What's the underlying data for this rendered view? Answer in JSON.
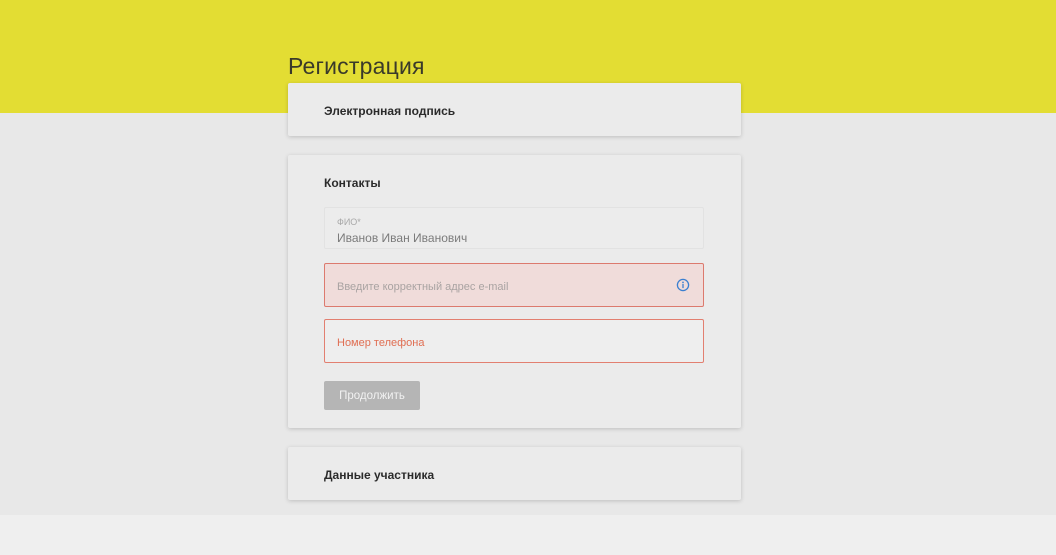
{
  "page": {
    "title": "Регистрация"
  },
  "sections": {
    "signature": {
      "title": "Электронная подпись"
    },
    "contacts": {
      "title": "Контакты",
      "fio": {
        "label": "ФИО*",
        "value": "Иванов Иван Иванович"
      },
      "email": {
        "placeholder": "Введите корректный адрес e-mail",
        "state": "error",
        "icon": "info-icon"
      },
      "phone": {
        "placeholder": "Номер телефона",
        "state": "error"
      },
      "continue_label": "Продолжить",
      "continue_state": "disabled"
    },
    "participant": {
      "title": "Данные участника"
    }
  },
  "colors": {
    "header_band": "#e3dd33",
    "background": "#e8e8e8",
    "error_border": "#dc7a6e",
    "error_fill": "#f0dcda",
    "error_text": "#e06e52",
    "info_icon": "#3b7fd0",
    "button_disabled": "#b5b5b5"
  }
}
